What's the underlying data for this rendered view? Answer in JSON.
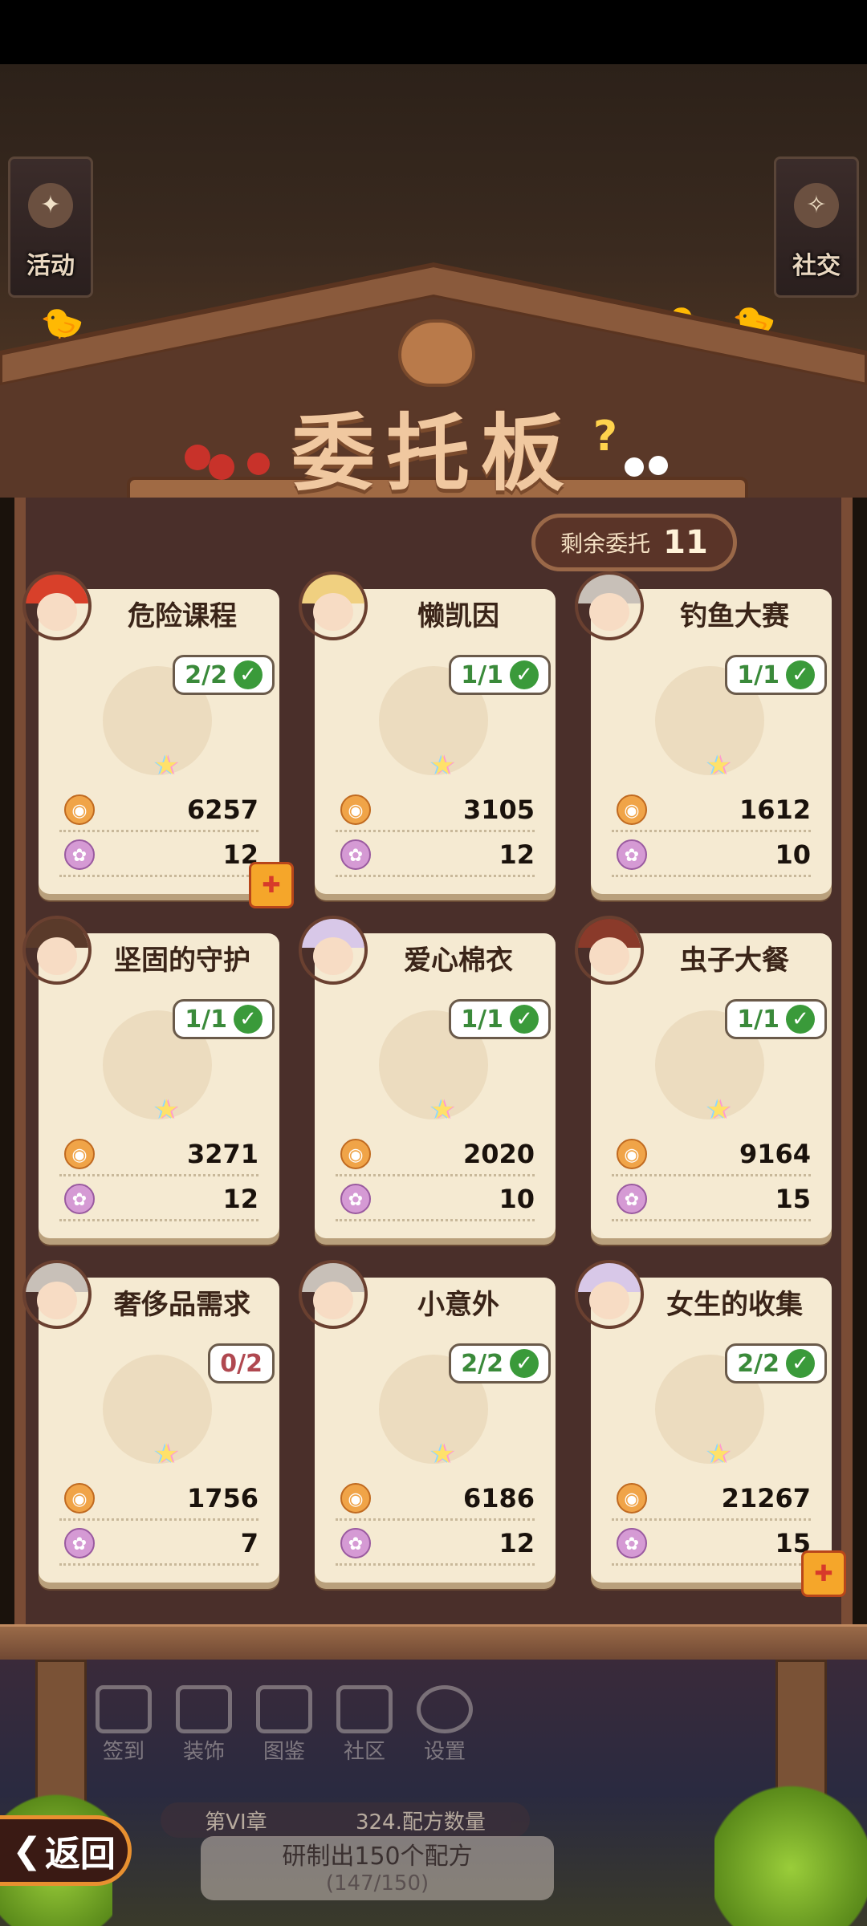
{
  "header": {
    "title": "委托板",
    "remaining_label": "剩余委托",
    "remaining_count": "11"
  },
  "side": {
    "left_label": "活动",
    "right_label": "社交"
  },
  "quests": [
    {
      "name": "危险课程",
      "progress": "2/2",
      "complete": true,
      "coins": "6257",
      "gems": "12",
      "item_icon": "fire-tornado-icon",
      "gift": true
    },
    {
      "name": "懒凯因",
      "progress": "1/1",
      "complete": true,
      "coins": "3105",
      "gems": "12",
      "item_icon": "blue-slime-icon",
      "gift": false
    },
    {
      "name": "钓鱼大赛",
      "progress": "1/1",
      "complete": true,
      "coins": "1612",
      "gems": "10",
      "item_icon": "fishing-rod-icon",
      "gift": false
    },
    {
      "name": "坚固的守护",
      "progress": "1/1",
      "complete": true,
      "coins": "3271",
      "gems": "12",
      "item_icon": "iron-block-icon",
      "gift": false
    },
    {
      "name": "爱心棉衣",
      "progress": "1/1",
      "complete": true,
      "coins": "2020",
      "gems": "10",
      "item_icon": "cotton-candy-icon",
      "gift": false
    },
    {
      "name": "虫子大餐",
      "progress": "1/1",
      "complete": true,
      "coins": "9164",
      "gems": "15",
      "item_icon": "bug-feast-icon",
      "gift": false
    },
    {
      "name": "奢侈品需求",
      "progress": "0/2",
      "complete": false,
      "coins": "1756",
      "gems": "7",
      "item_icon": "ruby-gem-icon",
      "gift": false
    },
    {
      "name": "小意外",
      "progress": "2/2",
      "complete": true,
      "coins": "6186",
      "gems": "12",
      "item_icon": "cream-bowl-icon",
      "gift": false
    },
    {
      "name": "女生的收集",
      "progress": "2/2",
      "complete": true,
      "coins": "21267",
      "gems": "15",
      "item_icon": "shell-necklace-icon",
      "gift": true
    }
  ],
  "bottom_nav": [
    {
      "label": "签到",
      "icon": "calendar-icon"
    },
    {
      "label": "装饰",
      "icon": "decorate-icon"
    },
    {
      "label": "图鉴",
      "icon": "book-icon"
    },
    {
      "label": "社区",
      "icon": "home-icon"
    },
    {
      "label": "设置",
      "icon": "gear-icon"
    }
  ],
  "chapter": {
    "name": "第VI章",
    "recipes": "324.配方数量"
  },
  "goal": {
    "text": "研制出150个配方",
    "progress": "(147/150)"
  },
  "back_label": "返回",
  "colors": {
    "complete_green": "#3a9a3a",
    "incomplete_red": "#b04850",
    "card_bg": "#f5ead2",
    "board_wood": "#4a2f2a"
  }
}
